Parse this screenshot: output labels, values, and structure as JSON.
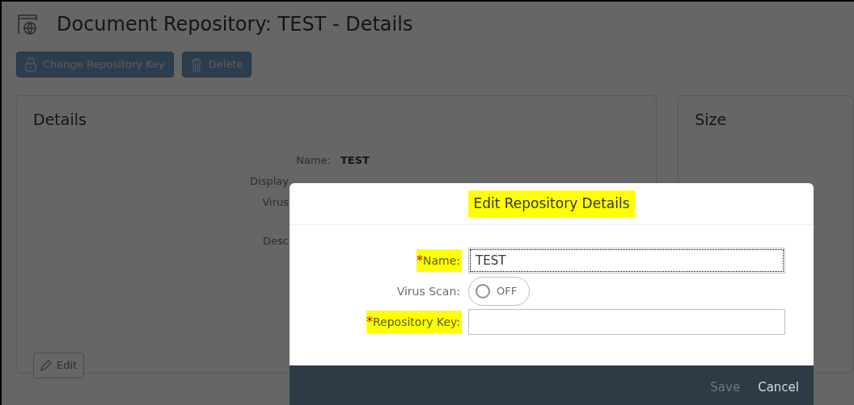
{
  "page": {
    "title": "Document Repository: TEST - Details",
    "toolbar": [
      {
        "kind": "lock",
        "label": "Change Repository Key"
      },
      {
        "kind": "trash",
        "label": "Delete"
      }
    ],
    "details_card": {
      "title": "Details",
      "rows": [
        {
          "label": "Name:",
          "value": "TEST"
        },
        {
          "label": "Display"
        },
        {
          "label": "Virus"
        },
        {
          "label": "Desc"
        }
      ],
      "edit_button": "Edit"
    },
    "size_card": {
      "title": "Size"
    }
  },
  "dialog": {
    "title": "Edit Repository Details",
    "title_highlighted": true,
    "fields": [
      {
        "kind": "text",
        "marker": "*",
        "label": "Name:",
        "required": true,
        "highlighted": true,
        "value": "TEST",
        "focused": true
      },
      {
        "kind": "switch",
        "label": "Virus Scan:",
        "required": false,
        "highlighted": false,
        "on": false,
        "state_text": "OFF"
      },
      {
        "kind": "text",
        "marker": "*",
        "label": "Repository Key:",
        "required": true,
        "highlighted": true,
        "focused": false
      }
    ],
    "buttons": [
      {
        "label": "Save",
        "disabled": true
      },
      {
        "label": "Cancel",
        "disabled": false
      }
    ]
  }
}
